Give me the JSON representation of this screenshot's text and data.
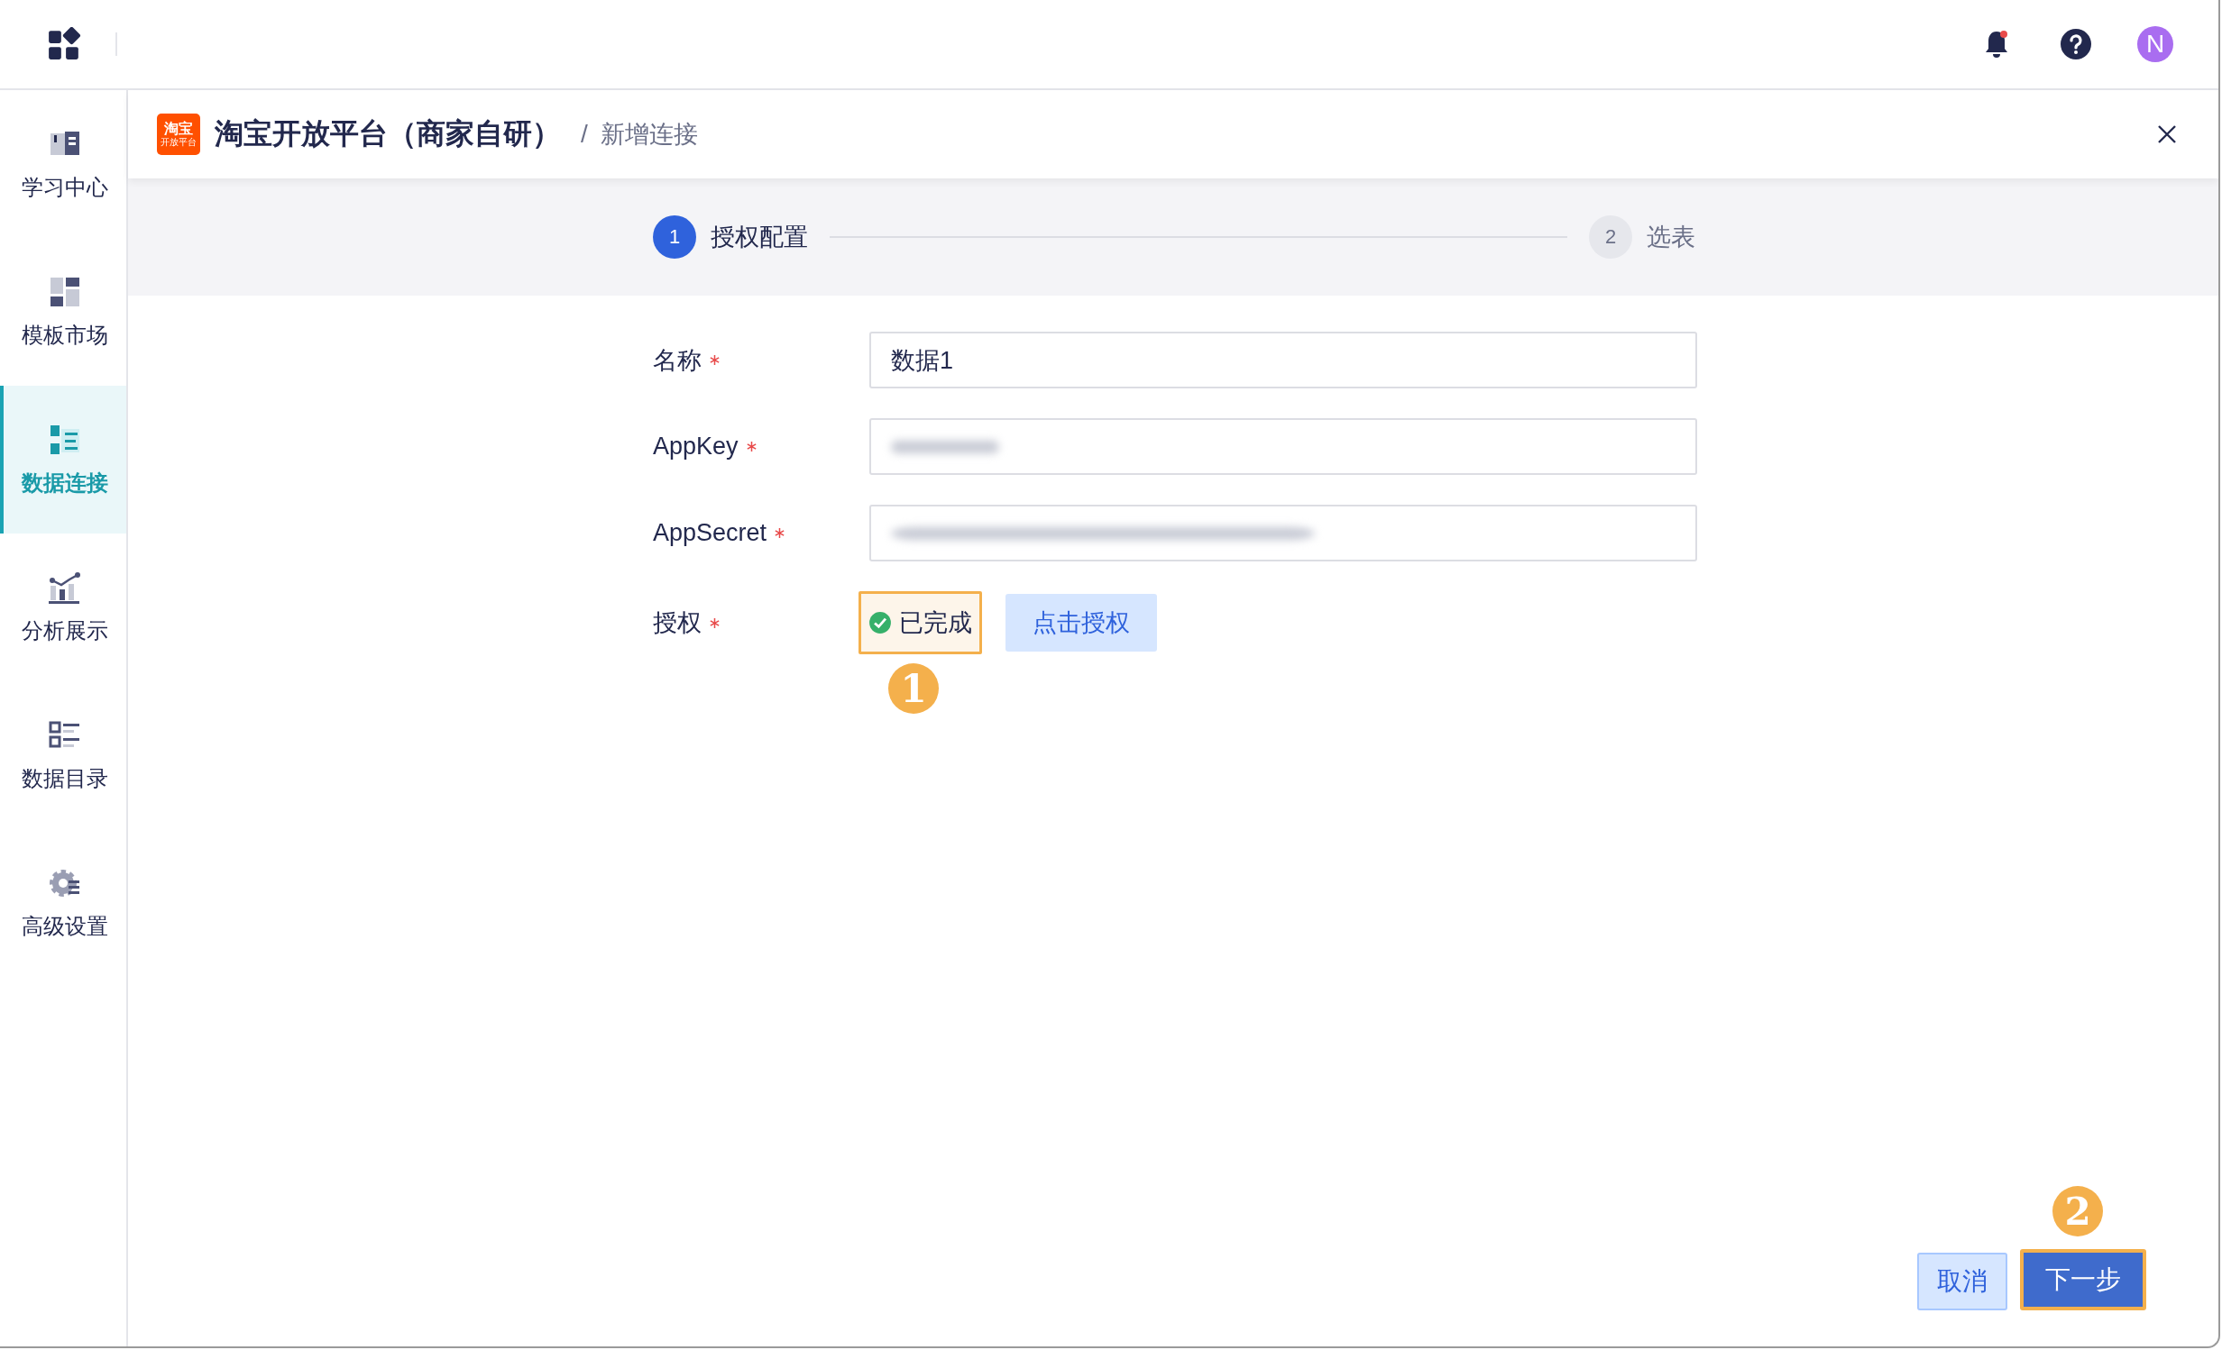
{
  "top_bar": {
    "avatar": "N",
    "notification_dot": true
  },
  "sidebar": {
    "items": [
      {
        "label": "学习中心",
        "kind": "book",
        "selected": false
      },
      {
        "label": "模板市场",
        "kind": "tiles",
        "selected": false
      },
      {
        "label": "数据连接",
        "kind": "connect",
        "selected": true
      },
      {
        "label": "分析展示",
        "kind": "chart",
        "selected": false
      },
      {
        "label": "数据目录",
        "kind": "list",
        "selected": false
      },
      {
        "label": "高级设置",
        "kind": "gear",
        "selected": false
      }
    ]
  },
  "header": {
    "logo": {
      "line_1": "淘宝",
      "line_2": "开放平台"
    },
    "title": "淘宝开放平台（商家自研）",
    "separator": "/",
    "breadcrumb": "新增连接"
  },
  "steps": [
    {
      "number": "1",
      "label": "授权配置",
      "selected": true
    },
    {
      "number": "2",
      "label": "选表",
      "selected": false
    }
  ],
  "form": {
    "fields": [
      {
        "kind": "input",
        "label": "名称",
        "required": true,
        "value": "数据1"
      },
      {
        "kind": "masked_short",
        "label": "AppKey",
        "required": true
      },
      {
        "kind": "masked_long",
        "label": "AppSecret",
        "required": true
      },
      {
        "kind": "auth",
        "label": "授权",
        "required": true,
        "status": "已完成",
        "done": true,
        "button": "点击授权",
        "marker": "1"
      }
    ]
  },
  "footer": {
    "cancel": "取消",
    "next": "下一步",
    "marker": "2"
  }
}
